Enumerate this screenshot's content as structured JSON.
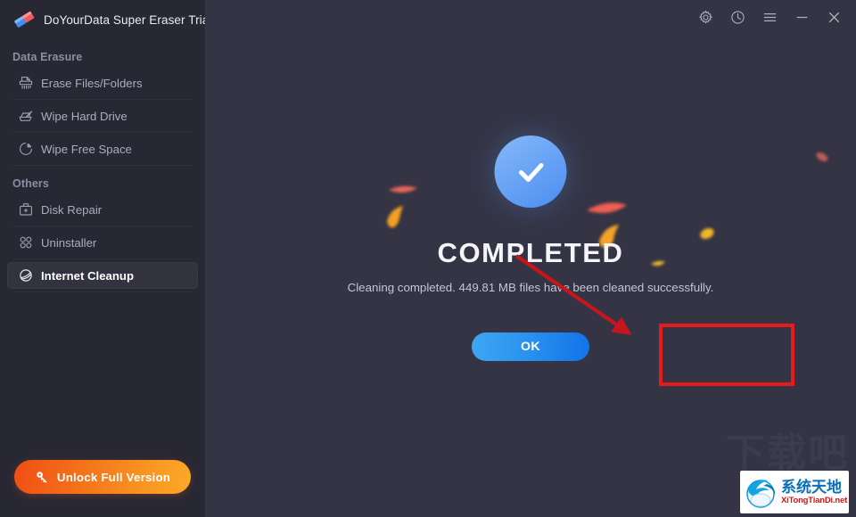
{
  "window": {
    "title": "DoYourData Super Eraser Trial",
    "logo_icon": "eraser-logo-icon",
    "controls": [
      {
        "name": "settings-button",
        "icon": "gear-icon",
        "label": "Settings"
      },
      {
        "name": "history-button",
        "icon": "clock-icon",
        "label": "History"
      },
      {
        "name": "menu-button",
        "icon": "hamburger-menu-icon",
        "label": "Menu"
      },
      {
        "name": "minimize-button",
        "icon": "minimize-icon",
        "label": "Minimize"
      },
      {
        "name": "close-button",
        "icon": "close-icon",
        "label": "Close"
      }
    ]
  },
  "sidebar": {
    "groups": [
      {
        "label": "Data Erasure",
        "items": [
          {
            "label": "Erase Files/Folders",
            "icon": "shredder-icon",
            "selected": false
          },
          {
            "label": "Wipe Hard Drive",
            "icon": "hard-drive-pencil-icon",
            "selected": false
          },
          {
            "label": "Wipe Free Space",
            "icon": "pie-chart-icon",
            "selected": false
          }
        ]
      },
      {
        "label": "Others",
        "items": [
          {
            "label": "Disk Repair",
            "icon": "first-aid-kit-icon",
            "selected": false
          },
          {
            "label": "Uninstaller",
            "icon": "grid-apps-icon",
            "selected": false
          },
          {
            "label": "Internet Cleanup",
            "icon": "globe-icon",
            "selected": true
          }
        ]
      }
    ],
    "unlock_button": {
      "label": "Unlock Full Version",
      "icon": "key-icon"
    }
  },
  "main": {
    "status_icon": "check-circle-icon",
    "title": "COMPLETED",
    "message": "Cleaning completed. 449.81 MB files have been cleaned successfully.",
    "ok_button": "OK"
  },
  "annotations": {
    "highlight_rect": {
      "color": "#e81b1b"
    },
    "arrow": {
      "color": "#c4161c"
    }
  },
  "watermark": {
    "ghost_text": "下载吧",
    "logo_cn": "系统天地",
    "logo_en": "XiTongTianDi.net"
  },
  "colors": {
    "sidebar_bg": "#282834",
    "main_bg": "#343444",
    "selected_bg": "#33333f",
    "accent_blue": "#2a93ef",
    "accent_orange": "#f4741a",
    "check_blue": "#6ba5f5",
    "annotation_red": "#e81b1b"
  }
}
